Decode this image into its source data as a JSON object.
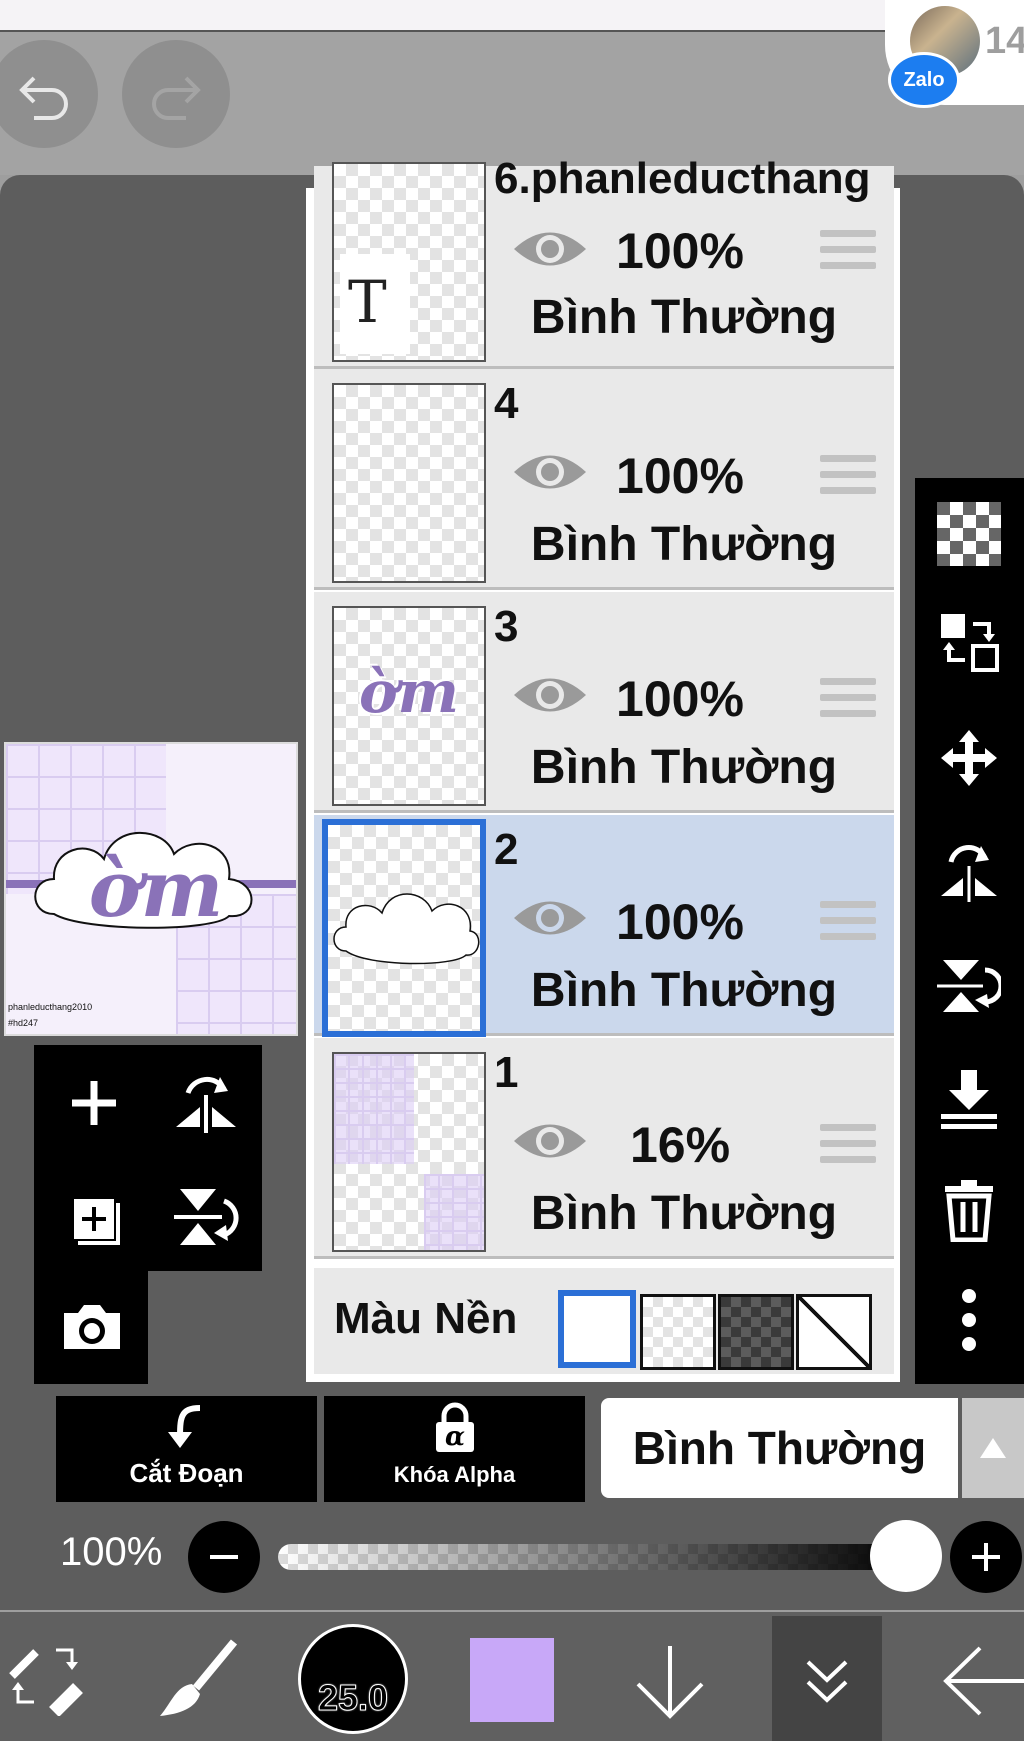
{
  "top": {
    "zalo_label": "Zalo",
    "badge_count": "14"
  },
  "thumbnail": {
    "credit": "phanleducthang2010",
    "tag": "#hd247",
    "art_text": "ờm"
  },
  "layers": [
    {
      "number": "6.phanleducthang",
      "opacity": "100%",
      "blend_mode": "Bình Thường",
      "thumb_text": "T"
    },
    {
      "number": "4",
      "opacity": "100%",
      "blend_mode": "Bình Thường"
    },
    {
      "number": "3",
      "opacity": "100%",
      "blend_mode": "Bình Thường",
      "thumb_text": "ờm"
    },
    {
      "number": "2",
      "opacity": "100%",
      "blend_mode": "Bình Thường",
      "selected": true
    },
    {
      "number": "1",
      "opacity": "16%",
      "blend_mode": "Bình Thường"
    }
  ],
  "background_row": {
    "label": "Màu Nền"
  },
  "actions": {
    "clip_label": "Cắt Đoạn",
    "alpha_lock_label": "Khóa Alpha",
    "alpha_symbol": "α"
  },
  "blend": {
    "current": "Bình Thường"
  },
  "opacity": {
    "value_label": "100%",
    "value": 1.0
  },
  "bottom": {
    "brush_size": "25.0",
    "current_color": "#c8a8f8"
  },
  "colors": {
    "selection_blue": "#2b6fd6",
    "selected_row": "#cbd8ec",
    "accent_purple": "#8a72b8"
  }
}
